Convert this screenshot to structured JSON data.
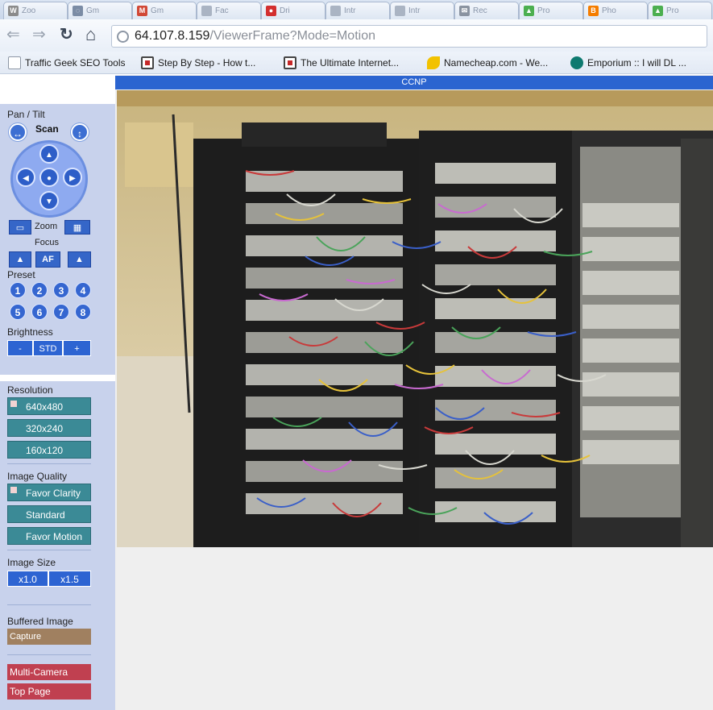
{
  "browser": {
    "tabs": [
      {
        "label": "Zoo",
        "icon": "w-icon",
        "color": "#8b8b8b",
        "glyph": "W"
      },
      {
        "label": "Gm",
        "icon": "globe-icon",
        "color": "#7b8ca5",
        "glyph": "◌"
      },
      {
        "label": "Gm",
        "icon": "gmail-icon",
        "color": "#d14836",
        "glyph": "M"
      },
      {
        "label": "Fac",
        "icon": "page-icon",
        "color": "#aab4c3",
        "glyph": ""
      },
      {
        "label": "Dri",
        "icon": "red-circle-icon",
        "color": "#d32f2f",
        "glyph": "●"
      },
      {
        "label": "Intr",
        "icon": "page-icon",
        "color": "#aab4c3",
        "glyph": ""
      },
      {
        "label": "Intr",
        "icon": "page-icon",
        "color": "#aab4c3",
        "glyph": ""
      },
      {
        "label": "Rec",
        "icon": "mail-icon",
        "color": "#8a93a0",
        "glyph": "✉"
      },
      {
        "label": "Pro",
        "icon": "tag-icon",
        "color": "#4caf50",
        "glyph": "▲"
      },
      {
        "label": "Pho",
        "icon": "blogger-icon",
        "color": "#f57d00",
        "glyph": "B"
      },
      {
        "label": "Pro",
        "icon": "tag-icon",
        "color": "#4caf50",
        "glyph": "▲"
      }
    ],
    "url_host": "64.107.8.159",
    "url_path": "/ViewerFrame?Mode=Motion",
    "bookmarks": [
      {
        "label": "Traffic Geek SEO Tools",
        "icon": "doc-icon",
        "kind": "doc"
      },
      {
        "label": "Step By Step - How t...",
        "icon": "red-square-icon",
        "kind": "red"
      },
      {
        "label": "The Ultimate Internet...",
        "icon": "red-square-icon",
        "kind": "red"
      },
      {
        "label": "Namecheap.com - We...",
        "icon": "namecheap-icon",
        "kind": "nc"
      },
      {
        "label": "Emporium :: I will DL ...",
        "icon": "emporium-icon",
        "kind": "em"
      }
    ]
  },
  "camera": {
    "title": "CCNP"
  },
  "controls": {
    "pan_tilt_label": "Pan / Tilt",
    "scan_label": "Scan",
    "zoom_label": "Zoom",
    "focus_label": "Focus",
    "focus_af": "AF",
    "preset_label": "Preset",
    "presets": [
      "1",
      "2",
      "3",
      "4",
      "5",
      "6",
      "7",
      "8"
    ],
    "brightness_label": "Brightness",
    "brightness_minus": "-",
    "brightness_std": "STD",
    "brightness_plus": "+",
    "resolution_label": "Resolution",
    "resolutions": [
      "640x480",
      "320x240",
      "160x120"
    ],
    "quality_label": "Image Quality",
    "qualities": [
      "Favor Clarity",
      "Standard",
      "Favor Motion"
    ],
    "size_label": "Image Size",
    "size_1": "x1.0",
    "size_2": "x1.5",
    "buffered_label": "Buffered Image",
    "capture_label": "Capture",
    "multi_camera": "Multi-Camera",
    "top_page": "Top Page"
  }
}
